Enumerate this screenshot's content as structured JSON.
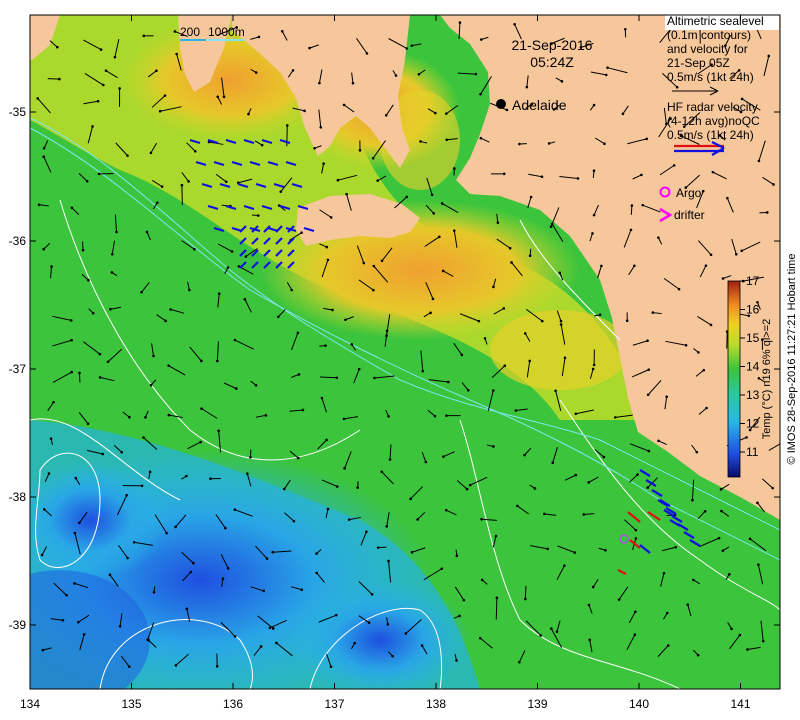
{
  "map": {
    "date": "21-Sep-2016",
    "time": "05:24Z",
    "scale_bar": [
      "200",
      "1000m"
    ],
    "city": "Adelaide",
    "x_ticks": [
      "134",
      "135",
      "136",
      "137",
      "138",
      "139",
      "140",
      "141"
    ],
    "y_ticks": [
      "-35",
      "-36",
      "-37",
      "-38",
      "-39"
    ]
  },
  "legend": {
    "altimetry_lines": [
      "Altimetric sealevel",
      "(0.1m contours)",
      "and velocity for",
      "21-Sep 05Z",
      "0.5m/s (1kt 24h)"
    ],
    "hf_lines": [
      "HF radar velocity",
      "(4-12h avg)noQC",
      "0.5m/s (1kt 24h)"
    ],
    "argo_label": "Argo",
    "drifter_label": "drifter",
    "colorbar_ticks": [
      "17",
      "16",
      "15",
      "14",
      "13",
      "12",
      "11"
    ],
    "colorbar_title": "Temp (°C) n19 6% ql>=2"
  },
  "credit": "© IMOS 28-Sep-2016 11:27:21 Hobart time",
  "colors": {
    "land": "#f7c79c",
    "cold": "#1f4fe0",
    "cool": "#29b6e6",
    "mid": "#3cc43c",
    "warm": "#e6d22a",
    "hot": "#f08a24",
    "hf_blue": "#1010e0",
    "hf_red": "#e01010",
    "argo": "#ff00ff"
  }
}
